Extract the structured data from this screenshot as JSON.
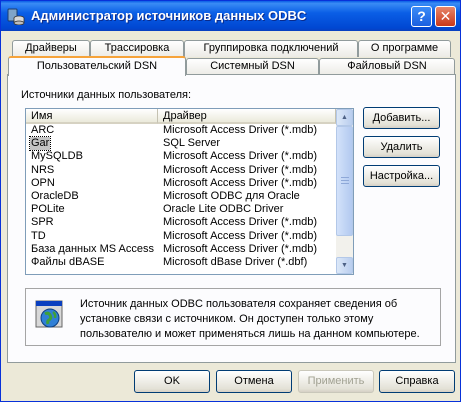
{
  "window": {
    "title": "Администратор источников данных ODBC",
    "help_label": "?",
    "close_label": "✕"
  },
  "tabs": {
    "top_row": [
      {
        "label": "Драйверы"
      },
      {
        "label": "Трассировка"
      },
      {
        "label": "Группировка подключений"
      },
      {
        "label": "О программе"
      }
    ],
    "bottom_row": [
      {
        "label": "Пользовательский DSN",
        "active": true
      },
      {
        "label": "Системный DSN"
      },
      {
        "label": "Файловый DSN"
      }
    ]
  },
  "dsn_list": {
    "label": "Источники данных пользователя:",
    "columns": [
      "Имя",
      "Драйвер"
    ],
    "rows": [
      {
        "name": "ARC",
        "driver": "Microsoft Access Driver (*.mdb)"
      },
      {
        "name": "Gar",
        "driver": "SQL Server",
        "selected": true
      },
      {
        "name": "MySQLDB",
        "driver": "Microsoft Access Driver (*.mdb)"
      },
      {
        "name": "NRS",
        "driver": "Microsoft Access Driver (*.mdb)"
      },
      {
        "name": "OPN",
        "driver": "Microsoft Access Driver (*.mdb)"
      },
      {
        "name": "OracleDB",
        "driver": "Microsoft ODBC для Oracle"
      },
      {
        "name": "POLite",
        "driver": "Oracle Lite ODBC Driver"
      },
      {
        "name": "SPR",
        "driver": "Microsoft Access Driver (*.mdb)"
      },
      {
        "name": "TD",
        "driver": "Microsoft Access Driver (*.mdb)"
      },
      {
        "name": "База данных MS Access",
        "driver": "Microsoft Access Driver (*.mdb)"
      },
      {
        "name": "Файлы dBASE",
        "driver": "Microsoft dBase Driver (*.dbf)"
      }
    ]
  },
  "side_buttons": {
    "add": "Добавить...",
    "remove": "Удалить",
    "configure": "Настройка..."
  },
  "info": {
    "text": "Источник данных ODBC пользователя сохраняет сведения об установке связи с источником.  Он доступен только этому пользователю и может применяться лишь на данном компьютере."
  },
  "footer_buttons": {
    "ok": "OK",
    "cancel": "Отмена",
    "apply": "Применить",
    "help": "Справка"
  },
  "colors": {
    "titlebar": "#0a5ee6",
    "dialog_bg": "#ece9d8",
    "panel_bg": "#fcfcfe",
    "active_tab_accent": "#f6a33a"
  }
}
